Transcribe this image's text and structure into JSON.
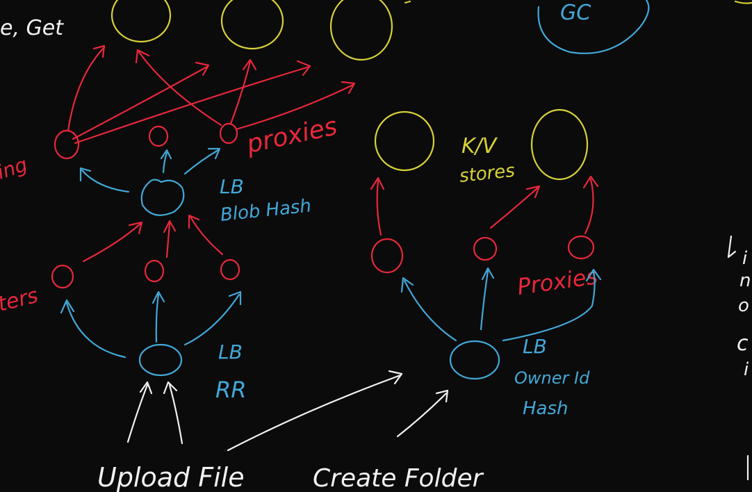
{
  "colors": {
    "background": "#0b0b0b",
    "white": "#f2f2f2",
    "red": "#e8283b",
    "blue": "#43a8d8",
    "yellow": "#d8d23a"
  },
  "labels": {
    "top_left": "e, Get",
    "gc": "GC",
    "proxies_top": "proxies",
    "left_red_1": "ing",
    "left_red_2": "ters",
    "lb_blob": "LB",
    "blob_hash": "Blob Hash",
    "lb_rr": "LB",
    "rr": "RR",
    "kv": "K/V",
    "stores": "stores",
    "proxies_right": "Proxies",
    "lb_owner": "LB",
    "owner_id": "Owner Id",
    "owner_hash": "Hash",
    "upload_file": "Upload File",
    "create_folder": "Create Folder",
    "right_edge_1": "i",
    "right_edge_2": "n",
    "right_edge_3": "o",
    "right_edge_4": "c",
    "right_edge_5": "i"
  }
}
